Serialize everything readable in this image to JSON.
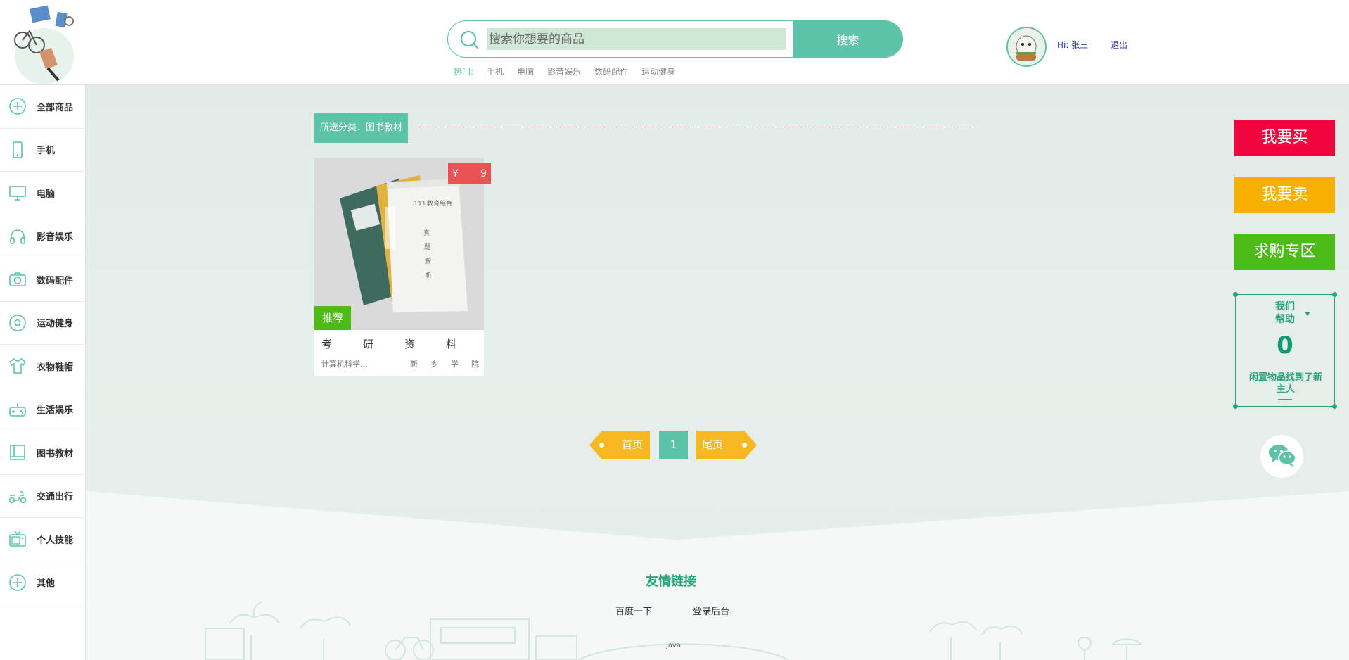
{
  "header": {
    "search": {
      "placeholder": "搜索你想要的商品",
      "button_label": "搜索"
    },
    "hot": {
      "label": "热门:",
      "items": [
        "手机",
        "电脑",
        "影音娱乐",
        "数码配件",
        "运动健身"
      ]
    },
    "user": {
      "greeting_prefix": "Hi:",
      "name": "张三",
      "logout_label": "退出"
    }
  },
  "sidebar": {
    "items": [
      {
        "label": "全部商品",
        "icon": "plus-circle-icon"
      },
      {
        "label": "手机",
        "icon": "phone-icon"
      },
      {
        "label": "电脑",
        "icon": "monitor-icon"
      },
      {
        "label": "影音娱乐",
        "icon": "headphones-icon"
      },
      {
        "label": "数码配件",
        "icon": "camera-icon"
      },
      {
        "label": "运动健身",
        "icon": "soccer-ball-icon"
      },
      {
        "label": "衣物鞋帽",
        "icon": "shirt-icon"
      },
      {
        "label": "生活娱乐",
        "icon": "gamepad-icon"
      },
      {
        "label": "图书教材",
        "icon": "book-icon"
      },
      {
        "label": "交通出行",
        "icon": "scooter-icon"
      },
      {
        "label": "个人技能",
        "icon": "tv-icon"
      },
      {
        "label": "其他",
        "icon": "plus-circle-icon"
      }
    ]
  },
  "main": {
    "category_label": "所选分类：图书教材",
    "product": {
      "currency": "¥",
      "price": "9",
      "badge": "推荐",
      "title": "考研资料",
      "category": "计算机科学...",
      "school": "新乡学院"
    },
    "pager": {
      "first_label": "首页",
      "current_page": "1",
      "last_label": "尾页"
    },
    "footer": {
      "title": "友情链接",
      "links": [
        "百度一下",
        "登录后台"
      ],
      "note": "java"
    }
  },
  "float_panel": {
    "buy_label": "我要买",
    "sell_label": "我要卖",
    "want_label": "求购专区",
    "help_title": "我们帮助",
    "help_count": "0",
    "help_text": "闲置物品找到了新主人"
  },
  "colors": {
    "accent": "#5cc2a8",
    "buy": "#f0053f",
    "sell": "#f7b000",
    "want": "#4cbb17",
    "price_tag": "#e95354",
    "pager": "#f7b720"
  }
}
